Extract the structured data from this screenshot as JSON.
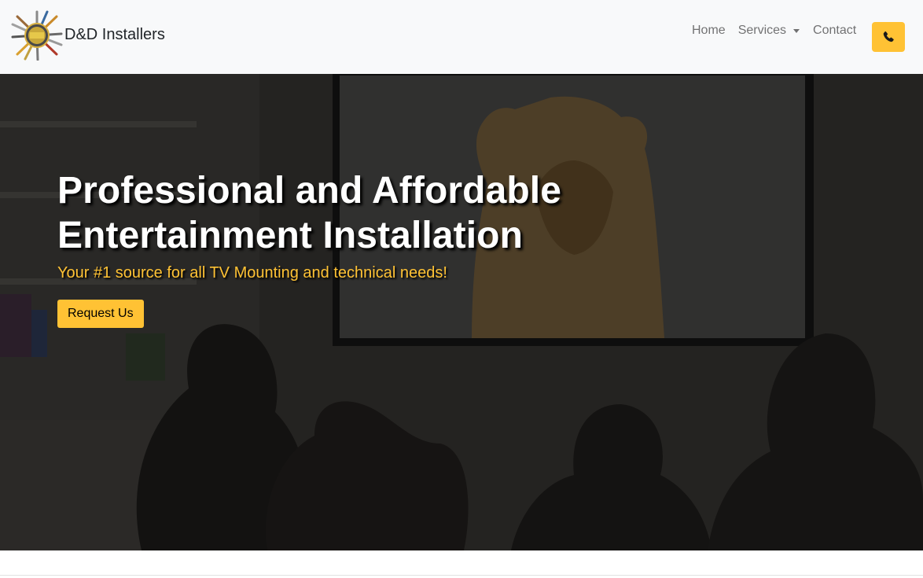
{
  "brand": {
    "name": "D&D Installers",
    "logo_icon": "tools-sunburst-logo"
  },
  "nav": {
    "home": "Home",
    "services": "Services",
    "contact": "Contact",
    "call_icon": "phone-icon"
  },
  "hero": {
    "title": "Professional and Affordable Entertainment Installation",
    "subtitle": "Your #1 source for all TV Mounting and technical needs!",
    "button": "Request Us"
  },
  "colors": {
    "accent": "#ffc234",
    "navbar_bg": "#f8f9fa",
    "hero_overlay": "#2b2a28"
  }
}
